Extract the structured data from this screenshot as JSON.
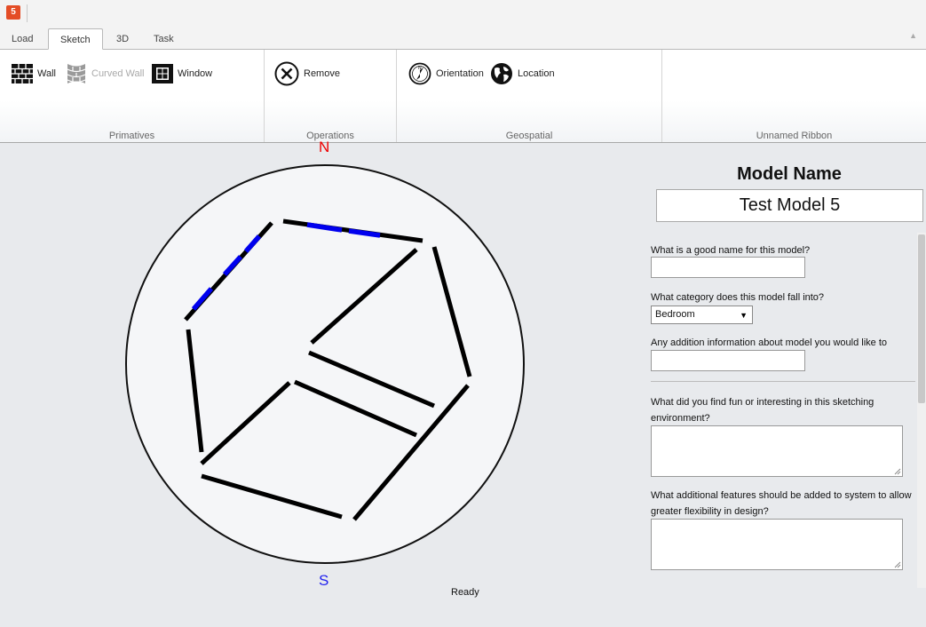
{
  "app": {
    "icon": "html5-icon",
    "icon_glyph": "5"
  },
  "tabs": [
    {
      "label": "Load",
      "active": false
    },
    {
      "label": "Sketch",
      "active": true
    },
    {
      "label": "3D",
      "active": false
    },
    {
      "label": "Task",
      "active": false
    }
  ],
  "ribbon": {
    "groups": {
      "primatives": {
        "label": "Primatives",
        "wall": "Wall",
        "curved_wall": "Curved Wall",
        "window": "Window"
      },
      "operations": {
        "label": "Operations",
        "remove": "Remove"
      },
      "geospatial": {
        "label": "Geospatial",
        "orientation": "Orientation",
        "location": "Location"
      },
      "unnamed": {
        "label": "Unnamed Ribbon"
      }
    }
  },
  "canvas": {
    "north": "N",
    "south": "S",
    "status": "Ready",
    "colors": {
      "wall": "#000000",
      "window": "#0000ee",
      "north": "#ee0000",
      "south": "#2222ee",
      "plate": "#f5f6f8"
    }
  },
  "form": {
    "title": "Model Name",
    "model_name": "Test Model 5",
    "q_name": "What is a good name for this model?",
    "name_value": "",
    "q_category": "What category does this model fall into?",
    "category_value": "Bedroom",
    "q_info": "Any addition information about model you would like to share?",
    "info_value": "",
    "q_fun": "What did you find fun or interesting in this sketching environment?",
    "fun_value": "",
    "q_features": "What additional features should be added to system to allow greater flexibility in design?",
    "features_value": ""
  }
}
